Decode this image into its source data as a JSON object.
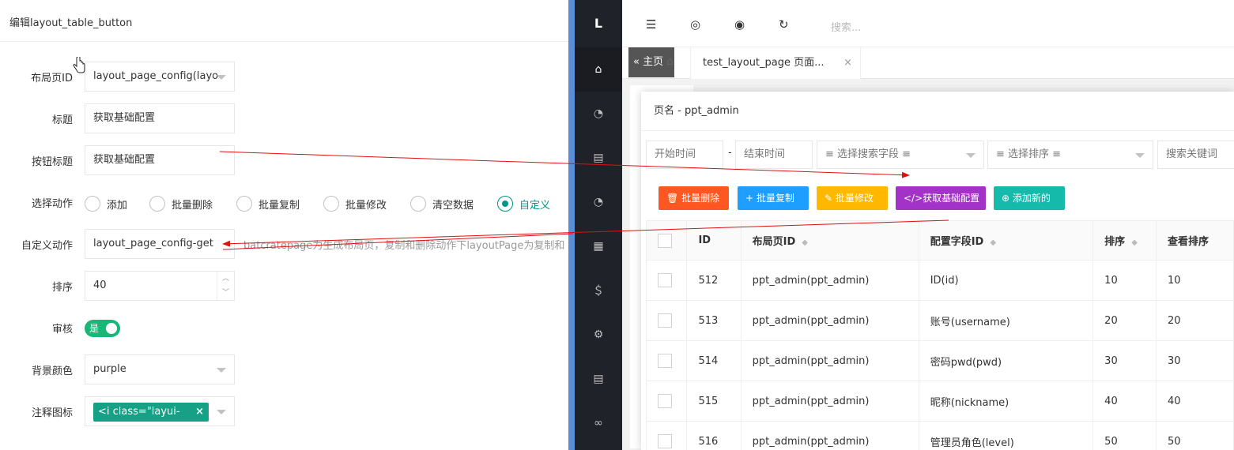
{
  "edit_panel": {
    "title": "编辑layout_table_button",
    "fields": {
      "layout_page_id": {
        "label": "布局页ID",
        "value": "layout_page_config(layo"
      },
      "title": {
        "label": "标题",
        "value": "获取基础配置"
      },
      "button_title": {
        "label": "按钮标题",
        "value": "获取基础配置"
      },
      "action": {
        "label": "选择动作",
        "options": [
          "添加",
          "批量删除",
          "批量复制",
          "批量修改",
          "清空数据",
          "自定义"
        ],
        "selected": "自定义"
      },
      "custom_action": {
        "label": "自定义动作",
        "value": "layout_page_config-get",
        "hint": "batcratepage为生成布局页，复制和删除动作下layoutPage为复制和"
      },
      "sort": {
        "label": "排序",
        "value": "40"
      },
      "review": {
        "label": "审核",
        "value": "是"
      },
      "bg_color": {
        "label": "背景颜色",
        "value": "purple"
      },
      "icon": {
        "label": "注释图标",
        "value": "<i class=\"layui-"
      }
    }
  },
  "admin": {
    "logo": "L",
    "topbar": {
      "search_placeholder": "搜索..."
    },
    "tabs": {
      "home": "主页",
      "page": "test_layout_page 页面...",
      "close": "×"
    },
    "dialog": {
      "title": "页名 - ppt_admin",
      "filters": {
        "start_time": "开始时间",
        "dash": "-",
        "end_time": "结束时间",
        "search_field": "≡ 选择搜索字段 ≡",
        "sort": "≡ 选择排序 ≡",
        "keyword": "搜索关键词"
      },
      "buttons": [
        {
          "label": "批量删除",
          "icon": "🗑",
          "color": "#ff5722"
        },
        {
          "label": "批量复制",
          "icon": "+",
          "color": "#1e9fff"
        },
        {
          "label": "批量修改",
          "icon": "✎",
          "color": "#ffb800"
        },
        {
          "label": "获取基础配置",
          "icon": "</>",
          "color": "#a233c6"
        },
        {
          "label": "添加新的",
          "icon": "⊕",
          "color": "#16baaa"
        }
      ],
      "table": {
        "headers": [
          "ID",
          "布局页ID",
          "配置字段ID",
          "排序",
          "查看排序"
        ],
        "rows": [
          [
            "512",
            "ppt_admin(ppt_admin)",
            "ID(id)",
            "10",
            "10"
          ],
          [
            "513",
            "ppt_admin(ppt_admin)",
            "账号(username)",
            "20",
            "20"
          ],
          [
            "514",
            "ppt_admin(ppt_admin)",
            "密码pwd(pwd)",
            "30",
            "30"
          ],
          [
            "515",
            "ppt_admin(ppt_admin)",
            "昵称(nickname)",
            "40",
            "40"
          ],
          [
            "516",
            "ppt_admin(ppt_admin)",
            "管理员角色(level)",
            "50",
            "50"
          ]
        ]
      }
    }
  },
  "colors": {
    "accent": "#009688",
    "switch_on": "#16b777",
    "arrow": "#e01010",
    "nav": "#20222a"
  }
}
